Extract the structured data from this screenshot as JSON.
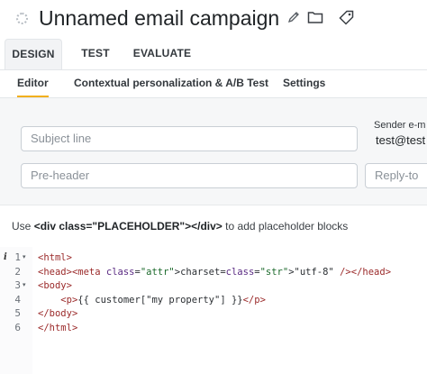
{
  "header": {
    "title": "Unnamed email campaign",
    "icons": [
      "status-spinner-icon",
      "pencil-icon",
      "folder-icon",
      "tag-icon"
    ]
  },
  "tabs": [
    {
      "label": "DESIGN",
      "active": true
    },
    {
      "label": "TEST",
      "active": false
    },
    {
      "label": "EVALUATE",
      "active": false
    }
  ],
  "subtabs": [
    {
      "label": "Editor",
      "active": true
    },
    {
      "label": "Contextual personalization & A/B Test",
      "active": false
    },
    {
      "label": "Settings",
      "active": false
    }
  ],
  "form": {
    "subject_placeholder": "Subject line",
    "preheader_placeholder": "Pre-header",
    "sender_label": "Sender e-m",
    "sender_value": "test@test",
    "reply_to_placeholder": "Reply-to"
  },
  "hint": {
    "prefix": "Use",
    "code": "<div class=\"PLACEHOLDER\"></div>",
    "suffix": "to add placeholder blocks"
  },
  "editor": {
    "line_numbers": [
      "1",
      "2",
      "3",
      "4",
      "5",
      "6"
    ],
    "fold_lines": [
      1,
      3
    ],
    "lines": [
      "<html>",
      "<head><meta charset=\"utf-8\" /></head>",
      "<body>",
      "    <p>{{ customer[\"my property\"] }}</p>",
      "</body>",
      "</html>"
    ]
  },
  "colors": {
    "accent": "#f2b01e",
    "tag": "#9b2a2a",
    "attr": "#5a2a82",
    "string": "#1c6a2c"
  }
}
